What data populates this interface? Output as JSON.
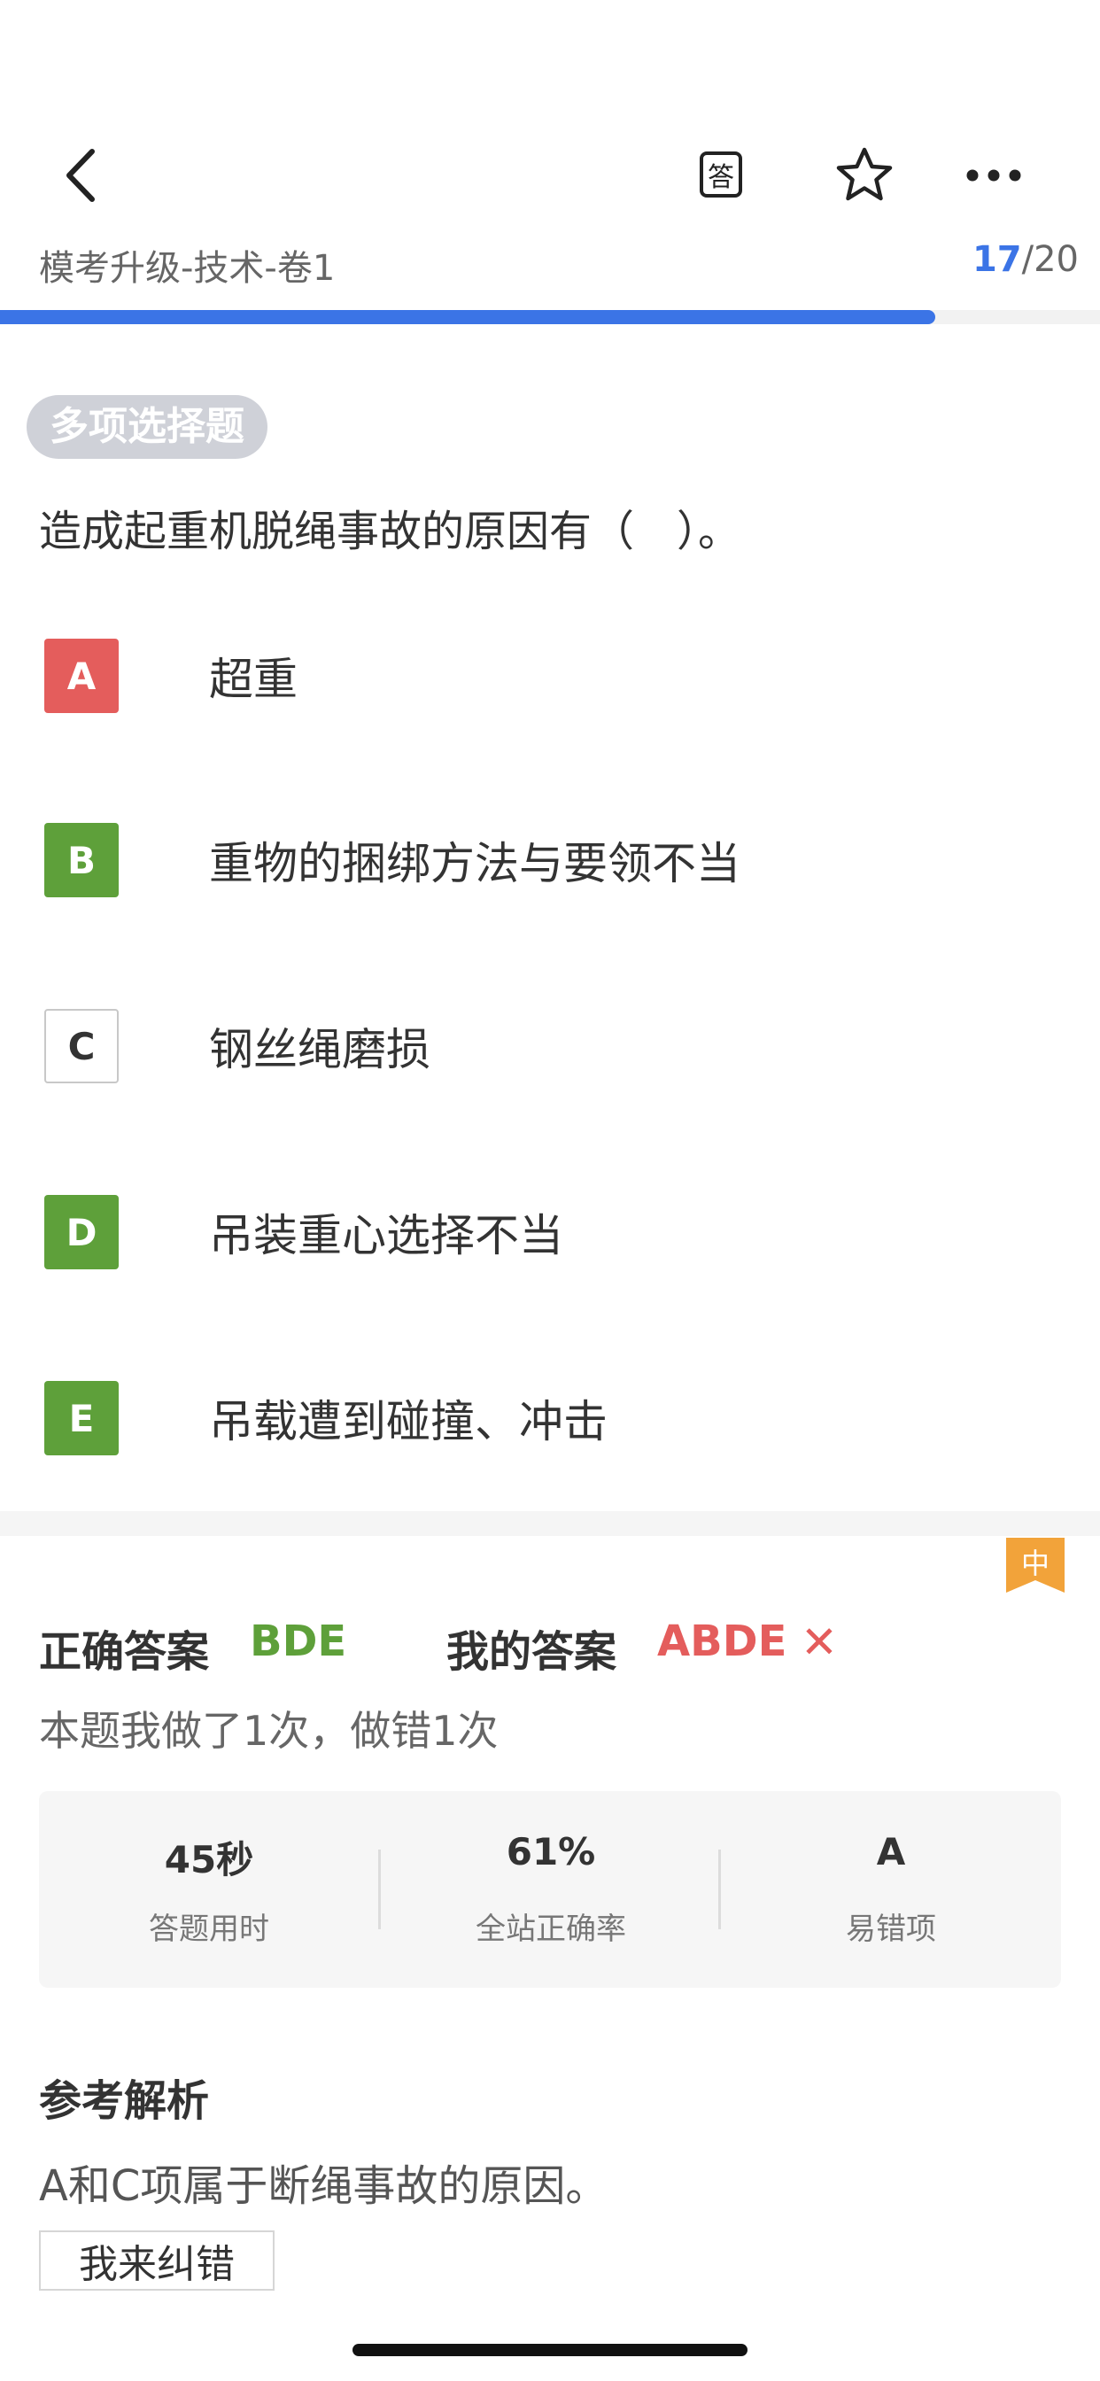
{
  "header": {
    "back_icon": "chevron-left-icon",
    "answer_sheet_icon_text": "答",
    "favorite_icon": "star-outline-icon",
    "more_icon": "ellipsis-icon"
  },
  "exam": {
    "title": "模考升级-技术-卷1",
    "current": "17",
    "separator": "/",
    "total": "20",
    "progress_fraction": 0.85
  },
  "question": {
    "type": "多项选择题",
    "text": "造成起重机脱绳事故的原因有（　）。",
    "options": [
      {
        "letter": "A",
        "text": "超重",
        "state": "wrong"
      },
      {
        "letter": "B",
        "text": "重物的捆绑方法与要领不当",
        "state": "correct"
      },
      {
        "letter": "C",
        "text": "钢丝绳磨损",
        "state": "none"
      },
      {
        "letter": "D",
        "text": "吊装重心选择不当",
        "state": "correct"
      },
      {
        "letter": "E",
        "text": "吊载遭到碰撞、冲击",
        "state": "correct"
      }
    ]
  },
  "difficulty": "中",
  "answer": {
    "correct_label": "正确答案",
    "correct_value": "BDE",
    "mine_label": "我的答案",
    "mine_value": "ABDE",
    "result_mark": "✕",
    "history": "本题我做了1次，做错1次"
  },
  "stats": [
    {
      "value": "45秒",
      "label": "答题用时"
    },
    {
      "value": "61%",
      "label": "全站正确率"
    },
    {
      "value": "A",
      "label": "易错项"
    }
  ],
  "analysis": {
    "title": "参考解析",
    "text": "A和C项属于断绳事故的原因。",
    "report_button": "我来纠错"
  },
  "colors": {
    "accent": "#3b74e6",
    "correct": "#5ea03a",
    "wrong": "#e45d5c",
    "difficulty": "#f2a33a"
  }
}
